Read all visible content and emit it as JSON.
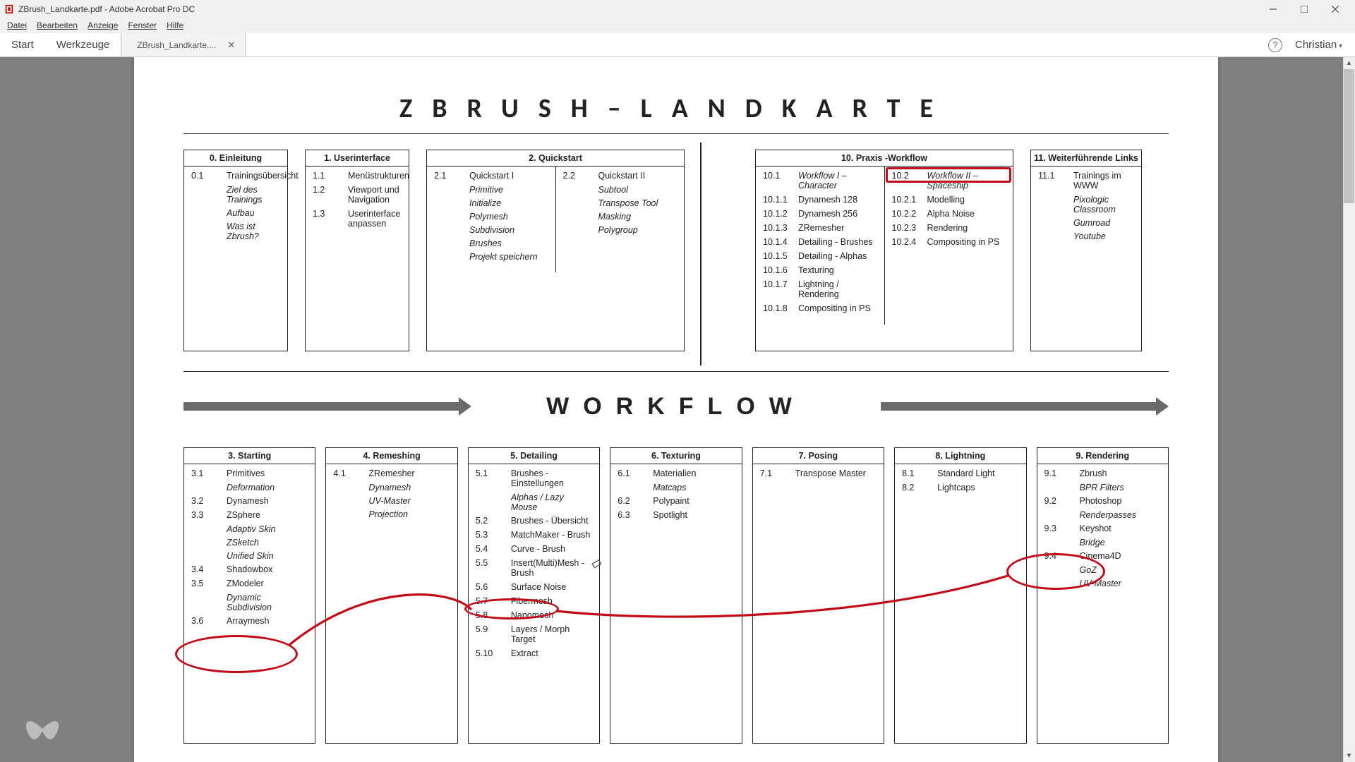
{
  "window": {
    "title": "ZBrush_Landkarte.pdf - Adobe Acrobat Pro DC"
  },
  "menu": {
    "file": "Datei",
    "edit": "Bearbeiten",
    "view": "Anzeige",
    "window": "Fenster",
    "help": "Hilfe"
  },
  "toolbar": {
    "start": "Start",
    "tools": "Werkzeuge",
    "doc_tab": "ZBrush_Landkarte....",
    "user": "Christian"
  },
  "doc": {
    "title": "ZBRUSH–LANDKARTE",
    "workflow_title": "WORKFLOW",
    "boxes_top": {
      "b0": {
        "header": "0. Einleitung",
        "items": [
          {
            "num": "0.1",
            "txt": "Trainingsübersicht"
          },
          {
            "sub": "Ziel des Trainings"
          },
          {
            "sub": "Aufbau"
          },
          {
            "sub": "Was ist Zbrush?"
          }
        ]
      },
      "b1": {
        "header": "1. Userinterface",
        "items": [
          {
            "num": "1.1",
            "txt": "Menüstrukturen"
          },
          {
            "num": "1.2",
            "txt": "Viewport und Navigation"
          },
          {
            "num": "1.3",
            "txt": "Userinterface anpassen"
          }
        ]
      },
      "b2": {
        "header": "2. Quickstart",
        "left": {
          "head": {
            "num": "2.1",
            "txt": "Quickstart I"
          },
          "subs": [
            "Primitive",
            "Initialize",
            "Polymesh",
            "Subdivision",
            "Brushes",
            "Projekt speichern"
          ]
        },
        "right": {
          "head": {
            "num": "2.2",
            "txt": "Quickstart II"
          },
          "subs": [
            "Subtool",
            "Transpose Tool",
            "Masking",
            "Polygroup"
          ]
        }
      },
      "b10": {
        "header": "10. Praxis -Workflow",
        "left": {
          "head": {
            "num": "10.1",
            "txt": "Workflow I – Character",
            "ital": true
          },
          "items": [
            {
              "num": "10.1.1",
              "txt": "Dynamesh 128"
            },
            {
              "num": "10.1.2",
              "txt": "Dynamesh 256"
            },
            {
              "num": "10.1.3",
              "txt": "ZRemesher"
            },
            {
              "num": "10.1.4",
              "txt": "Detailing - Brushes"
            },
            {
              "num": "10.1.5",
              "txt": "Detailing - Alphas"
            },
            {
              "num": "10.1.6",
              "txt": "Texturing"
            },
            {
              "num": "10.1.7",
              "txt": "Lightning / Rendering"
            },
            {
              "num": "10.1.8",
              "txt": "Compositing in PS"
            }
          ]
        },
        "right": {
          "head": {
            "num": "10.2",
            "txt": "Workflow II – Spaceship",
            "ital": true
          },
          "items": [
            {
              "num": "10.2.1",
              "txt": "Modelling"
            },
            {
              "num": "10.2.2",
              "txt": "Alpha Noise"
            },
            {
              "num": "10.2.3",
              "txt": "Rendering"
            },
            {
              "num": "10.2.4",
              "txt": "Compositing in PS"
            }
          ]
        }
      },
      "b11": {
        "header": "11. Weiterführende Links",
        "items": [
          {
            "num": "11.1",
            "txt": "Trainings im WWW"
          },
          {
            "sub": "Pixologic Classroom"
          },
          {
            "sub": "Gumroad"
          },
          {
            "sub": "Youtube"
          }
        ]
      }
    },
    "boxes_wf": {
      "b3": {
        "header": "3. Starting",
        "items": [
          {
            "num": "3.1",
            "txt": "Primitives"
          },
          {
            "sub": "Deformation"
          },
          {
            "num": "3.2",
            "txt": "Dynamesh"
          },
          {
            "num": "3.3",
            "txt": "ZSphere"
          },
          {
            "sub": "Adaptiv Skin"
          },
          {
            "sub": "ZSketch"
          },
          {
            "sub": "Unified Skin"
          },
          {
            "num": "3.4",
            "txt": "Shadowbox"
          },
          {
            "num": "3.5",
            "txt": "ZModeler"
          },
          {
            "sub": "Dynamic Subdivision"
          },
          {
            "num": "3.6",
            "txt": "Arraymesh"
          }
        ]
      },
      "b4": {
        "header": "4. Remeshing",
        "items": [
          {
            "num": "4.1",
            "txt": "ZRemesher"
          },
          {
            "sub": "Dynamesh"
          },
          {
            "sub": "UV-Master"
          },
          {
            "sub": "Projection"
          }
        ]
      },
      "b5": {
        "header": "5. Detailing",
        "items": [
          {
            "num": "5.1",
            "txt": "Brushes - Einstellungen"
          },
          {
            "sub": "Alphas / Lazy Mouse"
          },
          {
            "num": "5.2",
            "txt": "Brushes - Übersicht"
          },
          {
            "num": "5.3",
            "txt": "MatchMaker - Brush"
          },
          {
            "num": "5.4",
            "txt": "Curve - Brush"
          },
          {
            "num": "5.5",
            "txt": "Insert(Multi)Mesh - Brush"
          },
          {
            "num": "5.6",
            "txt": "Surface Noise"
          },
          {
            "num": "5.7",
            "txt": "Fibermesh"
          },
          {
            "num": "5.8",
            "txt": "Nanomesh"
          },
          {
            "num": "5.9",
            "txt": "Layers / Morph Target"
          },
          {
            "num": "5.10",
            "txt": "Extract"
          }
        ]
      },
      "b6": {
        "header": "6. Texturing",
        "items": [
          {
            "num": "6.1",
            "txt": "Materialien"
          },
          {
            "sub": "Matcaps"
          },
          {
            "num": "6.2",
            "txt": "Polypaint"
          },
          {
            "num": "6.3",
            "txt": "Spotlight"
          }
        ]
      },
      "b7": {
        "header": "7. Posing",
        "items": [
          {
            "num": "7.1",
            "txt": "Transpose Master"
          }
        ]
      },
      "b8": {
        "header": "8. Lightning",
        "items": [
          {
            "num": "8.1",
            "txt": "Standard Light"
          },
          {
            "num": "8.2",
            "txt": "Lightcaps"
          }
        ]
      },
      "b9": {
        "header": "9. Rendering",
        "items": [
          {
            "num": "9.1",
            "txt": "Zbrush"
          },
          {
            "sub": "BPR Filters"
          },
          {
            "num": "9.2",
            "txt": "Photoshop"
          },
          {
            "sub": "Renderpasses"
          },
          {
            "num": "9.3",
            "txt": "Keyshot"
          },
          {
            "sub": "Bridge"
          },
          {
            "num": "9.4",
            "txt": "Cinema4D"
          },
          {
            "sub": "GoZ"
          },
          {
            "sub": "UV-Master"
          }
        ]
      }
    }
  }
}
